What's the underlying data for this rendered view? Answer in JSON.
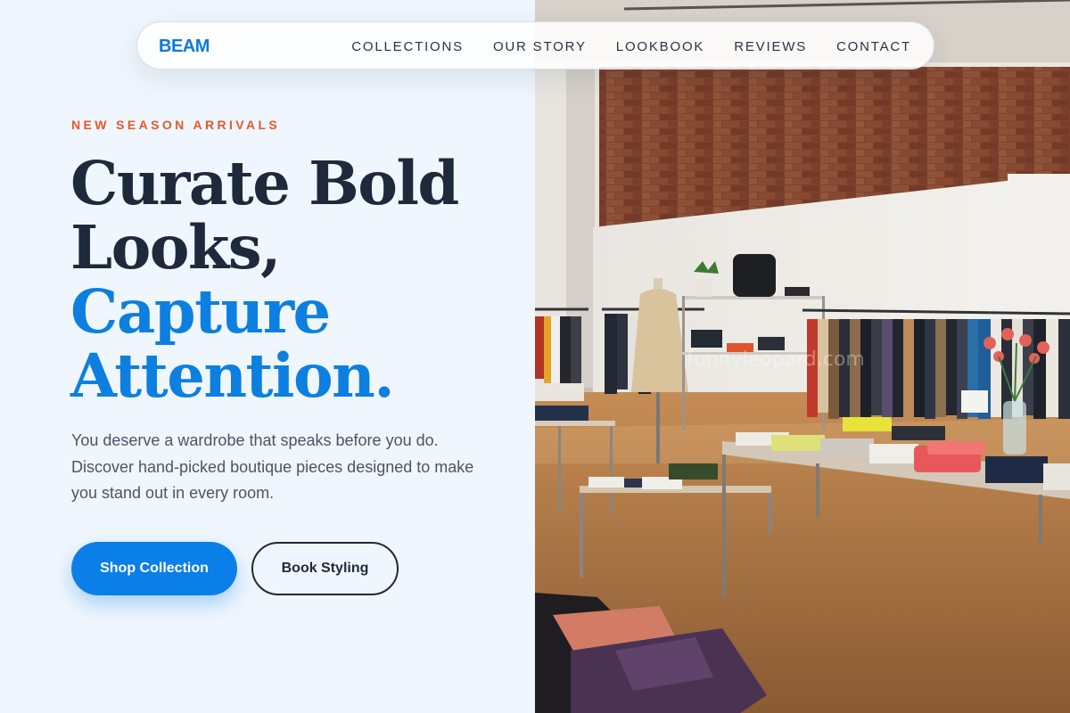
{
  "brand": {
    "name": "BEAM"
  },
  "nav": {
    "items": [
      {
        "label": "COLLECTIONS"
      },
      {
        "label": "OUR STORY"
      },
      {
        "label": "LOOKBOOK"
      },
      {
        "label": "REVIEWS"
      },
      {
        "label": "CONTACT"
      }
    ]
  },
  "hero": {
    "eyebrow": "NEW SEASON ARRIVALS",
    "headline_lines": [
      "Curate Bold",
      "Looks,"
    ],
    "headline_accent_lines": [
      "Capture",
      "Attention."
    ],
    "description": "You deserve a wardrobe that speaks before you do. Discover hand-picked boutique pieces designed to make you stand out in every room.",
    "primary_cta": "Shop Collection",
    "secondary_cta": "Book Styling"
  },
  "colors": {
    "brand": "#0a7bd8",
    "accent_headline": "#0c7fe0",
    "eyebrow": "#e8562a",
    "background": "#eff6fd",
    "primary_button": "#0b7fe8"
  }
}
